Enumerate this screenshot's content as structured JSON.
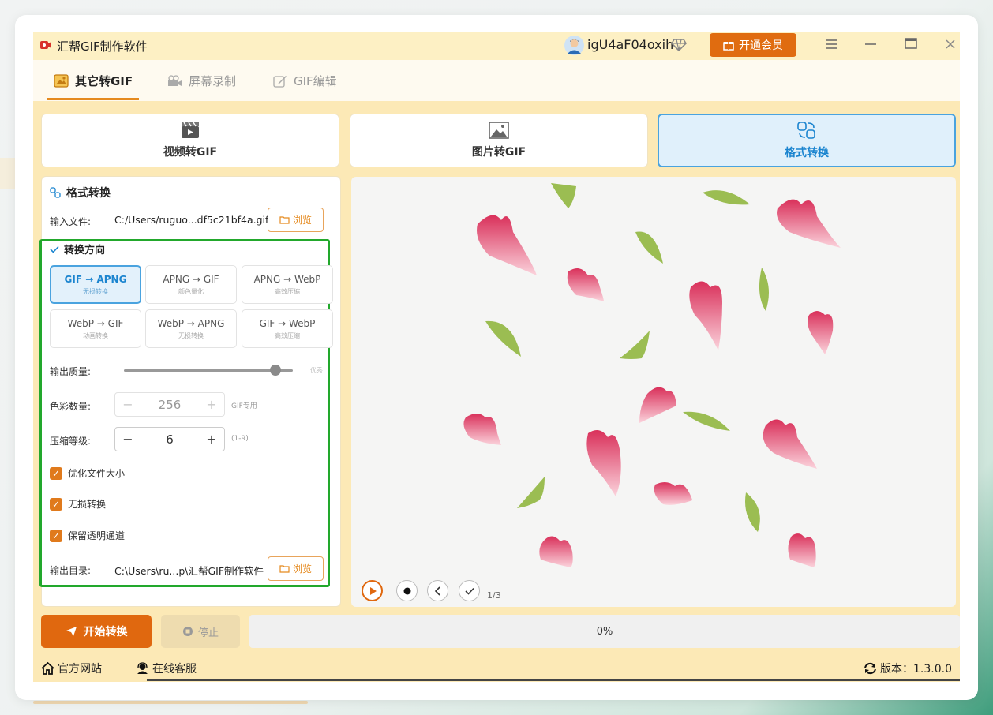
{
  "app": {
    "title": "汇帮GIF制作软件"
  },
  "user": {
    "name": "igU4aF04oxih",
    "vip_label": "开通会员"
  },
  "main_tabs": [
    {
      "label": "其它转GIF",
      "active": true
    },
    {
      "label": "屏幕录制",
      "active": false
    },
    {
      "label": "GIF编辑",
      "active": false
    }
  ],
  "mode_cards": [
    {
      "label": "视频转GIF",
      "icon": "film-icon",
      "active": false
    },
    {
      "label": "图片转GIF",
      "icon": "image-icon",
      "active": false
    },
    {
      "label": "格式转换",
      "icon": "convert-icon",
      "active": true
    }
  ],
  "format_panel": {
    "title": "格式转换",
    "input_label": "输入文件:",
    "input_path": "C:/Users/ruguo...df5c21bf4a.gif",
    "browse_label": "浏览",
    "direction_title": "转换方向",
    "conversions": [
      {
        "title": "GIF → APNG",
        "sub": "无损转换",
        "active": true
      },
      {
        "title": "APNG → GIF",
        "sub": "颜色量化",
        "active": false
      },
      {
        "title": "APNG → WebP",
        "sub": "高效压缩",
        "active": false
      },
      {
        "title": "WebP → GIF",
        "sub": "动画转换",
        "active": false
      },
      {
        "title": "WebP → APNG",
        "sub": "无损转换",
        "active": false
      },
      {
        "title": "GIF → WebP",
        "sub": "高效压缩",
        "active": false
      }
    ],
    "quality_label": "输出质量:",
    "quality_value": 90,
    "quality_text": "优秀",
    "colors_label": "色彩数量:",
    "colors_value": "256",
    "colors_hint": "GIF专用",
    "compress_label": "压缩等级:",
    "compress_value": "6",
    "compress_hint": "(1-9)",
    "checkboxes": [
      {
        "label": "优化文件大小",
        "checked": true
      },
      {
        "label": "无损转换",
        "checked": true
      },
      {
        "label": "保留透明通道",
        "checked": true
      }
    ],
    "output_label": "输出目录:",
    "output_path": "C:\\Users\\ru...p\\汇帮GIF制作软件"
  },
  "preview": {
    "frame_counter": "1/3"
  },
  "bottom": {
    "start_label": "开始转换",
    "stop_label": "停止",
    "progress_text": "0%",
    "progress": 0
  },
  "footer": {
    "website": "官方网站",
    "support": "在线客服",
    "version": "版本：1.3.0.0"
  },
  "colors": {
    "accent": "#e0680f",
    "selected_blue": "#4aa3df",
    "highlight_green": "#22a82c",
    "panel_bg": "#fce9b6"
  }
}
